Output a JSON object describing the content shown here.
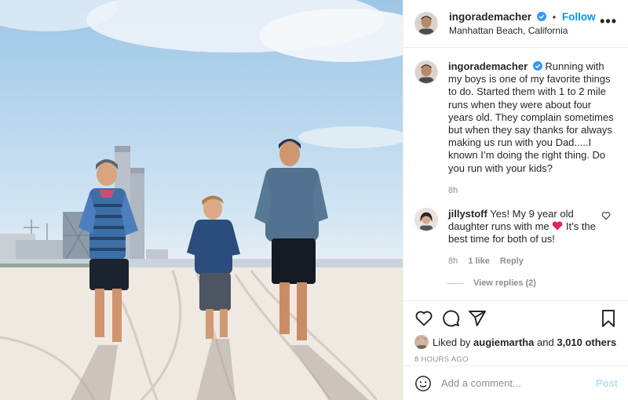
{
  "header": {
    "username": "ingorademacher",
    "dot": "•",
    "follow_label": "Follow",
    "location": "Manhattan Beach, California",
    "more_label": "•••"
  },
  "caption": {
    "username": "ingorademacher",
    "text": "Running with my boys is one of my favorite things to do. Started them with 1 to 2 mile runs when they were about four years old. They complain sometimes but when they say thanks for always making us run with you Dad.....I known I’m doing the right thing. Do you run with your kids?",
    "time": "8h"
  },
  "comment": {
    "username": "jillystoff",
    "text_before": "Yes! My 9 year old daughter runs with me",
    "text_after": "It’s the best time for both of us!",
    "time": "8h",
    "likes": "1 like",
    "reply_label": "Reply",
    "view_replies": "View replies (2)"
  },
  "likes": {
    "prefix": "Liked by",
    "user": "augiemartha",
    "connector": "and",
    "others": "3,010 others"
  },
  "timestamp": "8 HOURS AGO",
  "add_comment": {
    "placeholder": "Add a comment...",
    "post_label": "Post"
  },
  "colors": {
    "accent": "#0095f6",
    "post_disabled": "#b2dffc",
    "heart": "#ed4956",
    "muted": "#8e8e8e"
  },
  "icons": [
    "heart-icon",
    "comment-icon",
    "share-icon",
    "bookmark-icon",
    "emoji-icon",
    "verified-icon",
    "more-icon"
  ]
}
